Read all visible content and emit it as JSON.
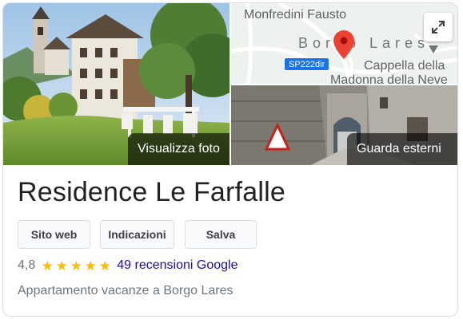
{
  "photos": {
    "main_caption": "Visualizza foto",
    "street_caption": "Guarda esterni"
  },
  "map": {
    "place_label": "Monfredini Fausto",
    "town_label": "Borgo Lares",
    "road_badge": "SP222dir",
    "poi_line1": "Cappella della",
    "poi_line2": "Madonna della Neve",
    "pin_color": "#ea4335",
    "expand_icon": "expand-icon"
  },
  "business": {
    "name": "Residence Le Farfalle",
    "category": "Appartamento vacanze a Borgo Lares"
  },
  "actions": {
    "website_label": "Sito web",
    "directions_label": "Indicazioni",
    "save_label": "Salva"
  },
  "rating": {
    "value": "4,8",
    "stars": 5,
    "star_color": "#fbbc04",
    "reviews_link": "49 recensioni Google",
    "link_color": "#1a0dab"
  }
}
